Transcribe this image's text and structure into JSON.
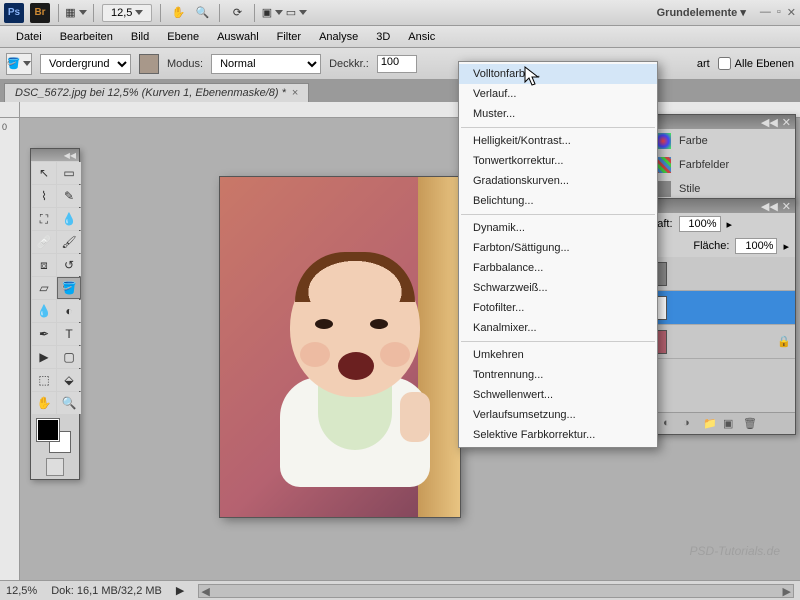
{
  "sysbar": {
    "ps_label": "Ps",
    "br_label": "Br",
    "zoom_value": "12,5",
    "workspace_label": "Grundelemente ▾"
  },
  "menubar": {
    "items": [
      "Datei",
      "Bearbeiten",
      "Bild",
      "Ebene",
      "Auswahl",
      "Filter",
      "Analyse",
      "3D",
      "Ansic"
    ]
  },
  "optbar": {
    "target_fg": "Vordergrund",
    "mode_label": "Modus:",
    "mode_value": "Normal",
    "opacity_label": "Deckkr.:",
    "opacity_value": "100",
    "all_layers_label": "Alle Ebenen",
    "art_label": "art"
  },
  "doctab": {
    "title": "DSC_5672.jpg bei 12,5% (Kurven 1, Ebenenmaske/8) *",
    "close": "×"
  },
  "dropdown": {
    "groups": [
      [
        "Volltonfarbe...",
        "Verlauf...",
        "Muster..."
      ],
      [
        "Helligkeit/Kontrast...",
        "Tonwertkorrektur...",
        "Gradationskurven...",
        "Belichtung..."
      ],
      [
        "Dynamik...",
        "Farbton/Sättigung...",
        "Farbbalance...",
        "Schwarzweiß...",
        "Fotofilter...",
        "Kanalmixer..."
      ],
      [
        "Umkehren",
        "Tontrennung...",
        "Schwellenwert...",
        "Verlaufsumsetzung...",
        "Selektive Farbkorrektur..."
      ]
    ],
    "highlighted": "Volltonfarbe..."
  },
  "panels": {
    "color": {
      "tab_farbe": "Farbe",
      "tab_swatches": "Farbfelder",
      "tab_stile": "Stile"
    },
    "layers": {
      "opacity_label": "Deckkraft:",
      "opacity_value": "100%",
      "fill_label": "Fläche:",
      "fill_value": "100%"
    }
  },
  "statusbar": {
    "zoom": "12,5%",
    "docinfo": "Dok: 16,1 MB/32,2 MB"
  },
  "ruler_v_zero": "0",
  "watermark": "PSD-Tutorials.de"
}
